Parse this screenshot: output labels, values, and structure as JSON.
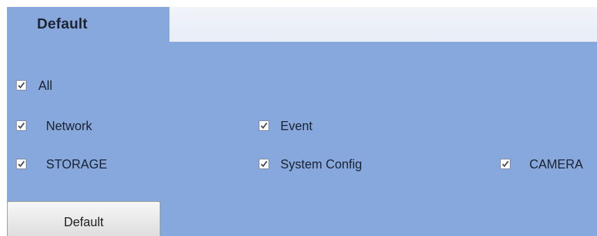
{
  "tabs": [
    {
      "label": "Default"
    }
  ],
  "options": {
    "all": {
      "label": "All",
      "checked": true
    },
    "network": {
      "label": "Network",
      "checked": true
    },
    "event": {
      "label": "Event",
      "checked": true
    },
    "storage": {
      "label": "STORAGE",
      "checked": true
    },
    "system_config": {
      "label": "System Config",
      "checked": true
    },
    "camera": {
      "label": "CAMERA",
      "checked": true
    }
  },
  "default_button": {
    "label": "Default"
  },
  "colors": {
    "panel": "#87a8dc",
    "tabbar": "#e9eef6"
  }
}
